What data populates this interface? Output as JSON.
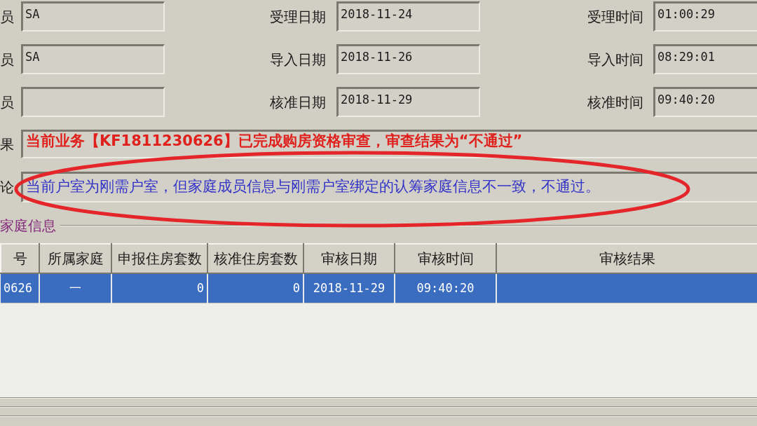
{
  "form_rows": [
    {
      "person": {
        "label": "员",
        "value": "SA"
      },
      "date": {
        "label": "受理日期",
        "value": "2018-11-24"
      },
      "time": {
        "label": "受理时间",
        "value": "01:00:29"
      }
    },
    {
      "person": {
        "label": "员",
        "value": "SA"
      },
      "date": {
        "label": "导入日期",
        "value": "2018-11-26"
      },
      "time": {
        "label": "导入时间",
        "value": "08:29:01"
      }
    },
    {
      "person": {
        "label": "员"
      },
      "date": {
        "label": "核准日期",
        "value": "2018-11-29"
      },
      "time": {
        "label": "核准时间",
        "value": "09:40:20"
      }
    }
  ],
  "result": {
    "label": "果",
    "text": "当前业务【KF1811230626】已完成购房资格审查，审查结果为“不通过”"
  },
  "conclusion": {
    "label": "论",
    "text": "当前户室为刚需户室，但家庭成员信息与刚需户室绑定的认筹家庭信息不一致，不通过。"
  },
  "family_info": {
    "title": "家庭信息",
    "columns": [
      "号",
      "所属家庭",
      "申报住房套数",
      "核准住房套数",
      "审核日期",
      "审核时间",
      "审核结果"
    ],
    "rows": [
      {
        "cells": [
          "0626",
          "一",
          "0",
          "0",
          "2018-11-29",
          "09:40:20"
        ],
        "selected": true
      }
    ]
  }
}
